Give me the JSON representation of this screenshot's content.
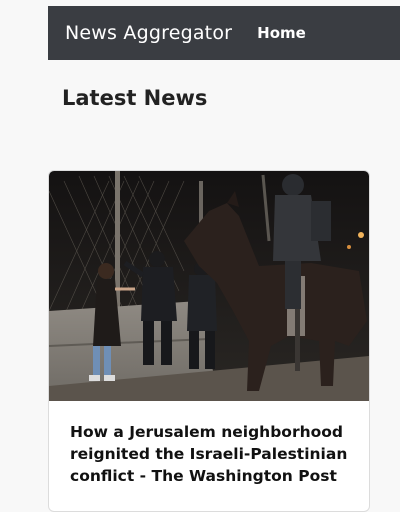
{
  "navbar": {
    "brand": "News Aggregator",
    "home_label": "Home"
  },
  "main": {
    "heading": "Latest News",
    "articles": [
      {
        "title": "How a Jerusalem neighborhood reignited the Israeli-Palestinian conflict - The Washington Post"
      }
    ]
  },
  "colors": {
    "navbar_bg": "#3a3d42",
    "page_bg": "#f8f8f8",
    "card_bg": "#ffffff"
  }
}
